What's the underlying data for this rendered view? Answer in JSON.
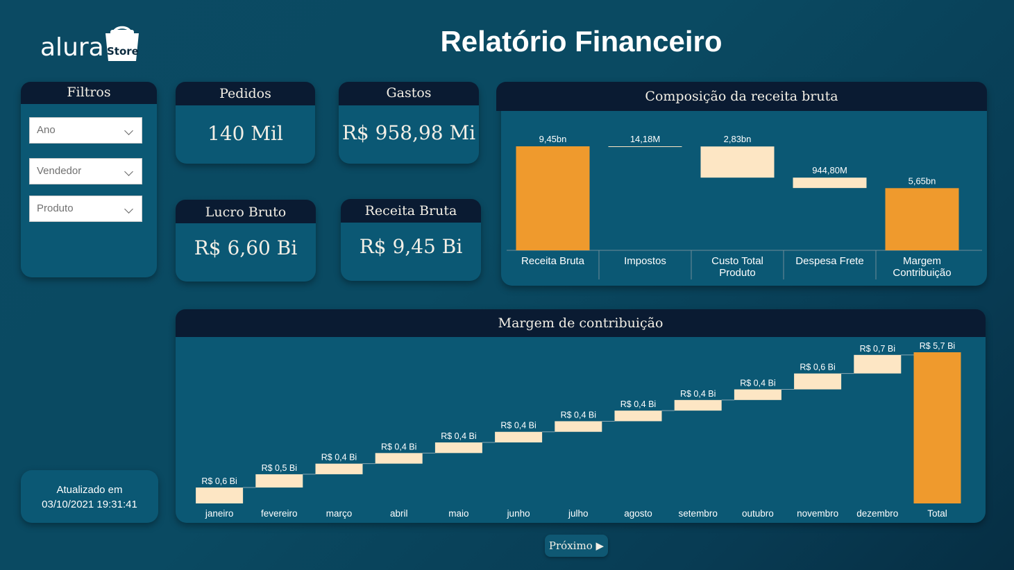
{
  "header": {
    "title": "Relatório Financeiro",
    "logo_text": "alura",
    "logo_badge": "Store"
  },
  "filters": {
    "title": "Filtros",
    "dropdowns": [
      {
        "placeholder": "Ano"
      },
      {
        "placeholder": "Vendedor"
      },
      {
        "placeholder": "Produto"
      }
    ]
  },
  "kpis": {
    "pedidos": {
      "label": "Pedidos",
      "value": "140 Mil"
    },
    "gastos": {
      "label": "Gastos",
      "value": "R$ 958,98 Mi"
    },
    "lucro": {
      "label": "Lucro Bruto",
      "value": "R$ 6,60 Bi"
    },
    "receita": {
      "label": "Receita Bruta",
      "value": "R$ 9,45 Bi"
    }
  },
  "updated": {
    "label": "Atualizado em",
    "datetime": "03/10/2021 19:31:41"
  },
  "next_button": {
    "label": "Próximo"
  },
  "colors": {
    "orange": "#ef9a2d",
    "cream": "#fde6c4",
    "header": "#0a1b32",
    "card": "#0b5874"
  },
  "chart_data": [
    {
      "type": "bar",
      "title": "Composição da receita bruta",
      "categories": [
        "Receita Bruta",
        "Impostos",
        "Custo Total Produto",
        "Despesa Frete",
        "Margem Contribuição"
      ],
      "values": [
        9450000000,
        14180000,
        2830000000,
        944800000,
        5650000000
      ],
      "data_labels": [
        "9,45bn",
        "14,18M",
        "2,83bn",
        "944,80M",
        "5,65bn"
      ],
      "bar_kinds": [
        "total",
        "decrease",
        "decrease",
        "decrease",
        "total"
      ],
      "xlabel": "",
      "ylabel": "",
      "ylim": [
        0,
        9450000000
      ],
      "grid": false
    },
    {
      "type": "bar",
      "title": "Margem de contribuição",
      "categories": [
        "janeiro",
        "fevereiro",
        "março",
        "abril",
        "maio",
        "junho",
        "julho",
        "agosto",
        "setembro",
        "outubro",
        "novembro",
        "dezembro",
        "Total"
      ],
      "values": [
        0.6,
        0.5,
        0.4,
        0.4,
        0.4,
        0.4,
        0.4,
        0.4,
        0.4,
        0.4,
        0.6,
        0.7,
        5.7
      ],
      "data_labels": [
        "R$ 0,6 Bi",
        "R$ 0,5 Bi",
        "R$ 0,4 Bi",
        "R$ 0,4 Bi",
        "R$ 0,4 Bi",
        "R$ 0,4 Bi",
        "R$ 0,4 Bi",
        "R$ 0,4 Bi",
        "R$ 0,4 Bi",
        "R$ 0,4 Bi",
        "R$ 0,6 Bi",
        "R$ 0,7 Bi",
        "R$ 5,7 Bi"
      ],
      "unit": "R$ Bi",
      "xlabel": "",
      "ylabel": "",
      "ylim": [
        0,
        5.7
      ],
      "grid": false
    }
  ]
}
